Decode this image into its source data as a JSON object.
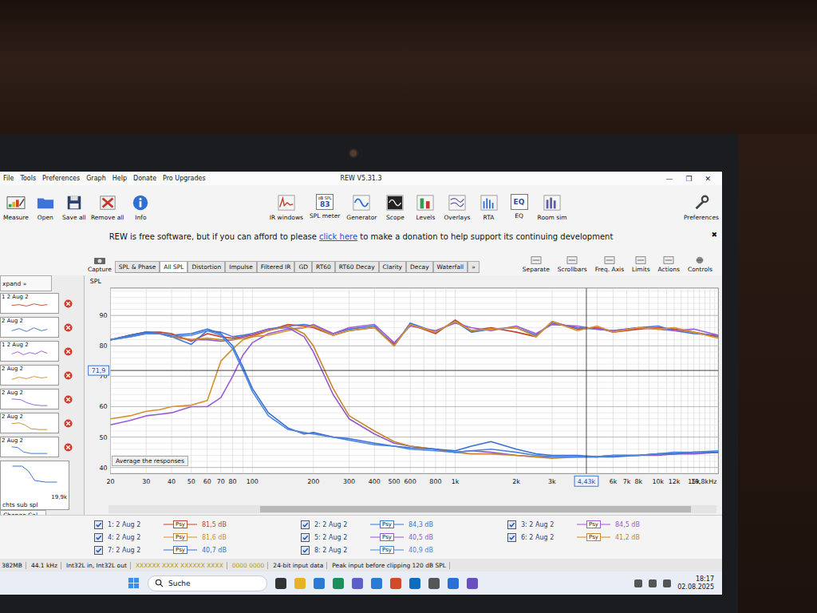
{
  "window": {
    "title": "REW V5.31.3",
    "controls": [
      "—",
      "❐",
      "✕"
    ]
  },
  "menu": [
    "File",
    "Tools",
    "Preferences",
    "Graph",
    "Help",
    "Donate",
    "Pro Upgrades"
  ],
  "toolbar_left": [
    {
      "label": "Measure"
    },
    {
      "label": "Open"
    },
    {
      "label": "Save all"
    },
    {
      "label": "Remove all"
    },
    {
      "label": "Info"
    }
  ],
  "toolbar_center": [
    {
      "label": "IR windows",
      "icon_text": []
    },
    {
      "label": "SPL meter",
      "icon_text": [
        "dB SPL",
        "83"
      ]
    },
    {
      "label": "Generator",
      "icon_text": []
    },
    {
      "label": "Scope",
      "icon_text": []
    },
    {
      "label": "Levels",
      "icon_text": []
    },
    {
      "label": "Overlays",
      "icon_text": []
    },
    {
      "label": "RTA",
      "icon_text": []
    },
    {
      "label": "EQ",
      "icon_text": [
        "EQ"
      ]
    },
    {
      "label": "Room sim",
      "icon_text": []
    }
  ],
  "toolbar_right": {
    "label": "Preferences"
  },
  "banner": {
    "before": "REW is free software, but if you can afford to please ",
    "link": "click here",
    "after": " to make a donation to help support its continuing development",
    "close": "✖"
  },
  "tabs": [
    {
      "label": "SPL & Phase",
      "selected": false
    },
    {
      "label": "All SPL",
      "selected": true
    },
    {
      "label": "Distortion",
      "selected": false
    },
    {
      "label": "Impulse",
      "selected": false
    },
    {
      "label": "Filtered IR",
      "selected": false
    },
    {
      "label": "GD",
      "selected": false
    },
    {
      "label": "RT60",
      "selected": false
    },
    {
      "label": "RT60 Decay",
      "selected": false
    },
    {
      "label": "Clarity",
      "selected": false
    },
    {
      "label": "Decay",
      "selected": false
    },
    {
      "label": "Waterfall",
      "selected": false
    },
    {
      "label": "»",
      "selected": false
    }
  ],
  "capture": "Capture",
  "graph_tools": [
    "Separate",
    "Scrollbars",
    "Freq. Axis",
    "Limits",
    "Actions",
    "Controls"
  ],
  "sidebar": {
    "expand": "xpand »",
    "items": [
      {
        "name": "1 2 Aug 2",
        "color": "#c2452e",
        "selected": false
      },
      {
        "name": "2 Aug 2",
        "color": "#3d74d6",
        "selected": false
      },
      {
        "name": "1 2 Aug 2",
        "color": "#9b5bd4",
        "selected": false
      },
      {
        "name": "2 Aug 2",
        "color": "#d4922e",
        "selected": false
      },
      {
        "name": "2 Aug 2",
        "color": "#8e5ccc",
        "selected": false
      },
      {
        "name": "2 Aug 2",
        "color": "#c8862c",
        "selected": false
      },
      {
        "name": "2 Aug 2",
        "color": "#3a6fd2",
        "selected": false
      }
    ],
    "preview": {
      "axis_label": "19,9k",
      "name": "chts sub spl"
    },
    "change_cal": "Change Cal..."
  },
  "chart": {
    "y_title": "SPL",
    "average_button": "Average the responses",
    "y_ticks": [
      {
        "label": "90",
        "value": 90
      },
      {
        "label": "80",
        "value": 80
      },
      {
        "label": "70",
        "value": 70
      },
      {
        "label": "60",
        "value": 60
      },
      {
        "label": "50",
        "value": 50
      },
      {
        "label": "40",
        "value": 40
      }
    ],
    "x_ticks": [
      {
        "label": "20",
        "freq": 20
      },
      {
        "label": "30",
        "freq": 30
      },
      {
        "label": "40",
        "freq": 40
      },
      {
        "label": "50",
        "freq": 50
      },
      {
        "label": "60",
        "freq": 60
      },
      {
        "label": "70",
        "freq": 70
      },
      {
        "label": "80",
        "freq": 80
      },
      {
        "label": "100",
        "freq": 100
      },
      {
        "label": "200",
        "freq": 200
      },
      {
        "label": "300",
        "freq": 300
      },
      {
        "label": "400",
        "freq": 400
      },
      {
        "label": "500",
        "freq": 500
      },
      {
        "label": "600",
        "freq": 600
      },
      {
        "label": "800",
        "freq": 800
      },
      {
        "label": "1k",
        "freq": 1000
      },
      {
        "label": "2k",
        "freq": 2000
      },
      {
        "label": "3k",
        "freq": 3000
      },
      {
        "label": "6k",
        "freq": 6000
      },
      {
        "label": "7k",
        "freq": 7000
      },
      {
        "label": "8k",
        "freq": 8000
      },
      {
        "label": "10k",
        "freq": 10000
      },
      {
        "label": "12k",
        "freq": 12000
      },
      {
        "label": "15k",
        "freq": 15000
      },
      {
        "label": "19,8kHz",
        "freq": 18000
      }
    ],
    "cursor": {
      "freq": 4430,
      "freq_label": "4,43k",
      "spl": 71.9,
      "spl_label": "71,9"
    },
    "frequencies": [
      20,
      25,
      30,
      35,
      40,
      50,
      60,
      70,
      80,
      90,
      100,
      120,
      150,
      180,
      200,
      250,
      300,
      400,
      500,
      600,
      800,
      1000,
      1200,
      1500,
      2000,
      2500,
      3000,
      4000,
      5000,
      6000,
      8000,
      10000,
      12000,
      15000,
      19800
    ]
  },
  "measurements": [
    {
      "name": "1: 2 Aug 2",
      "checked": true,
      "tag": "Psy",
      "value": "81,5 dB",
      "color": "#c2452e",
      "spl": [
        82,
        83.5,
        84.5,
        84.5,
        84,
        81.5,
        84,
        83,
        82.5,
        83,
        83.5,
        85,
        87,
        86.5,
        86,
        83.5,
        85,
        86,
        80.5,
        87,
        84,
        88.5,
        85,
        86,
        84.5,
        83,
        88,
        85.5,
        86,
        84.5,
        85.5,
        86,
        85.5,
        84.5,
        83
      ]
    },
    {
      "name": "2: 2 Aug 2",
      "checked": true,
      "tag": "Psy",
      "value": "84,3 dB",
      "color": "#3d74d6",
      "spl": [
        82,
        83,
        84,
        84,
        83,
        80.5,
        85,
        84.5,
        83,
        83.5,
        84,
        85.5,
        86.5,
        87,
        86.5,
        84,
        85.5,
        86.5,
        80,
        87.5,
        84.5,
        88,
        84.5,
        85.5,
        86,
        83.5,
        87.5,
        86,
        85.5,
        85,
        86,
        86.5,
        85,
        84,
        83.5
      ]
    },
    {
      "name": "3: 2 Aug 2",
      "checked": true,
      "tag": "Psy",
      "value": "84,5 dB",
      "color": "#9b5bd4",
      "spl": [
        54,
        55.5,
        57,
        57.5,
        58,
        60,
        60,
        63,
        70,
        77,
        81,
        84,
        85.5,
        86,
        87,
        84,
        86,
        87,
        81,
        86.5,
        85,
        87.5,
        86,
        85,
        86.5,
        84,
        87,
        86.5,
        85.5,
        85,
        86,
        85.5,
        85,
        85.5,
        83.5
      ]
    },
    {
      "name": "4: 2 Aug 2",
      "checked": true,
      "tag": "Psy",
      "value": "81,6 dB",
      "color": "#d4922e",
      "spl": [
        56,
        57,
        58.5,
        59,
        60,
        60.5,
        62,
        75,
        79,
        82,
        83,
        83.5,
        85,
        86,
        86.5,
        83.5,
        85,
        86,
        80,
        87,
        84.5,
        88,
        85,
        85.5,
        86,
        83,
        88,
        85,
        86.5,
        84.5,
        86,
        85.5,
        86,
        84.5,
        82.5
      ]
    },
    {
      "name": "5: 2 Aug 2",
      "checked": true,
      "tag": "Psy",
      "value": "40,5 dB",
      "color": "#8e5ccc",
      "spl": [
        82,
        83.5,
        84.5,
        84,
        83,
        82,
        82,
        81.5,
        82,
        83,
        84,
        85.5,
        86,
        83,
        78,
        64,
        56,
        51,
        48,
        47,
        46,
        45,
        45.5,
        45,
        44,
        43.5,
        43.5,
        43.5,
        43.5,
        44,
        44,
        44,
        44.5,
        44.5,
        45
      ]
    },
    {
      "name": "6: 2 Aug 2",
      "checked": true,
      "tag": "Psy",
      "value": "41,2 dB",
      "color": "#c8862c",
      "spl": [
        82,
        83.5,
        84.5,
        84,
        83,
        82,
        82.5,
        82,
        82,
        82.5,
        83,
        85,
        86.5,
        84,
        80,
        66,
        57,
        52,
        48.5,
        47,
        46,
        45,
        44.5,
        44.5,
        44,
        43.5,
        43,
        43.5,
        43.5,
        44,
        44,
        44.5,
        44.5,
        45,
        45
      ]
    },
    {
      "name": "7: 2 Aug 2",
      "checked": true,
      "tag": "Psy",
      "value": "40,7 dB",
      "color": "#3a6fd2",
      "spl": [
        82,
        83.5,
        84.5,
        84,
        83.5,
        84,
        85.5,
        84,
        80,
        73,
        66,
        58,
        53,
        51,
        51.5,
        50,
        49.5,
        48,
        47,
        46.5,
        46,
        45.5,
        47,
        48.5,
        46,
        44.5,
        44,
        44,
        43.5,
        43.5,
        44,
        44.5,
        44.5,
        45,
        45
      ]
    },
    {
      "name": "8: 2 Aug 2",
      "checked": true,
      "tag": "Psy",
      "value": "40,9 dB",
      "color": "#4d86dc",
      "spl": [
        82,
        83,
        84,
        84,
        83,
        83.5,
        85,
        83.5,
        79,
        72,
        65,
        57,
        52.5,
        51.5,
        51,
        50,
        49,
        47.5,
        47,
        46,
        45.5,
        45,
        45.5,
        46,
        45,
        44,
        43.5,
        43.5,
        43.5,
        44,
        44,
        44.5,
        45,
        45,
        45.5
      ]
    }
  ],
  "status_bar": [
    "382MB",
    "44.1 kHz",
    "Int32L in, Int32L out",
    "XXXXXX XXXX XXXXXX XXXX",
    "0000 0000",
    "24-bit input data",
    "Peak input before clipping 120 dB SPL"
  ],
  "taskbar": {
    "search": "Suche",
    "time": "18:17",
    "date": "02.08.2025"
  }
}
